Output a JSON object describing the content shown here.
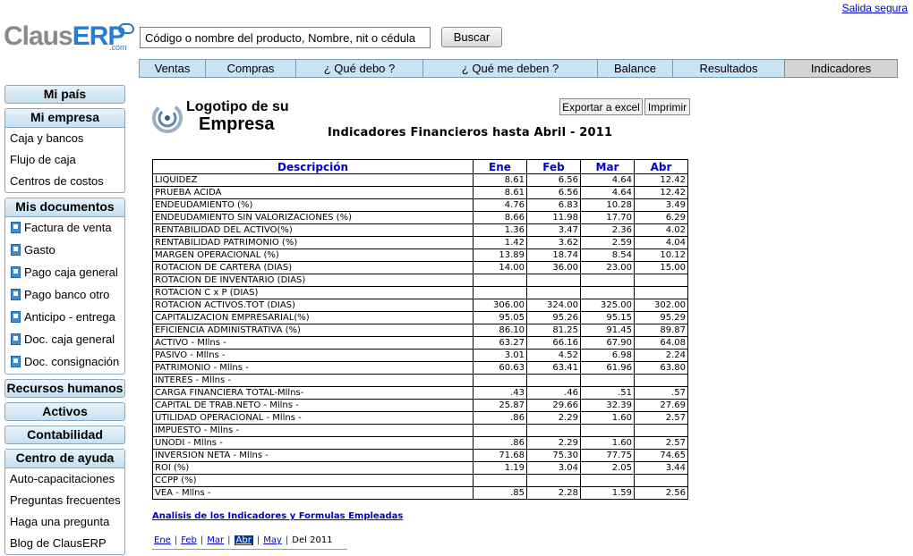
{
  "header": {
    "logout_link": "Salida segura",
    "logo_part1": "Claus",
    "logo_part2": "ERP",
    "logo_suffix": ".com",
    "search_value": "Código o nombre del producto, Nombre, nit o cédula",
    "search_button": "Buscar"
  },
  "tabs": [
    {
      "label": "Ventas"
    },
    {
      "label": "Compras"
    },
    {
      "label": "¿ Qué debo ?"
    },
    {
      "label": "¿ Qué me deben ?"
    },
    {
      "label": "Balance"
    },
    {
      "label": "Resultados"
    },
    {
      "label": "Indicadores"
    }
  ],
  "sidebar": {
    "mi_pais": "Mi país",
    "mi_empresa": {
      "title": "Mi empresa",
      "items": [
        "Caja y bancos",
        "Flujo de caja",
        "Centros de costos"
      ]
    },
    "mis_documentos": {
      "title": "Mis documentos",
      "items": [
        "Factura de venta",
        "Gasto",
        "Pago caja general",
        "Pago banco otro",
        "Anticipo - entrega",
        "Doc. caja general",
        "Doc. consignación"
      ]
    },
    "recursos_humanos": "Recursos humanos",
    "activos": "Activos",
    "contabilidad": "Contabilidad",
    "centro_ayuda": {
      "title": "Centro de ayuda",
      "items": [
        "Auto-capacitaciones",
        "Preguntas frecuentes",
        "Haga una pregunta",
        "Blog de ClausERP"
      ]
    }
  },
  "main": {
    "company_logo_line1": "Logotipo de su",
    "company_logo_line2": "Empresa",
    "export_button": "Exportar a excel",
    "print_button": "Imprimir",
    "report_title": "Indicadores Financieros hasta Abril - 2011",
    "table": {
      "headers": [
        "Descripción",
        "Ene",
        "Feb",
        "Mar",
        "Abr"
      ],
      "rows": [
        [
          "LIQUIDEZ",
          "8.61",
          "6.56",
          "4.64",
          "12.42"
        ],
        [
          "PRUEBA ACIDA",
          "8.61",
          "6.56",
          "4.64",
          "12.42"
        ],
        [
          "ENDEUDAMIENTO (%)",
          "4.76",
          "6.83",
          "10.28",
          "3.49"
        ],
        [
          "ENDEUDAMIENTO SIN VALORIZACIONES (%)",
          "8.66",
          "11.98",
          "17.70",
          "6.29"
        ],
        [
          "RENTABILIDAD DEL ACTIVO(%)",
          "1.36",
          "3.47",
          "2.36",
          "4.02"
        ],
        [
          "RENTABILIDAD PATRIMONIO (%)",
          "1.42",
          "3.62",
          "2.59",
          "4.04"
        ],
        [
          "MARGEN OPERACIONAL (%)",
          "13.89",
          "18.74",
          "8.54",
          "10.12"
        ],
        [
          "ROTACION DE CARTERA (DIAS)",
          "14.00",
          "36.00",
          "23.00",
          "15.00"
        ],
        [
          "ROTACION DE INVENTARIO (DIAS)",
          "",
          "",
          "",
          ""
        ],
        [
          "ROTACION C x P (DIAS)",
          "",
          "",
          "",
          ""
        ],
        [
          "ROTACION ACTIVOS.TOT (DIAS)",
          "306.00",
          "324.00",
          "325.00",
          "302.00"
        ],
        [
          "CAPITALIZACION EMPRESARIAL(%)",
          "95.05",
          "95.26",
          "95.15",
          "95.29"
        ],
        [
          "EFICIENCIA ADMINISTRATIVA (%)",
          "86.10",
          "81.25",
          "91.45",
          "89.87"
        ],
        [
          "ACTIVO - Mllns -",
          "63.27",
          "66.16",
          "67.90",
          "64.08"
        ],
        [
          "PASIVO - Mllns -",
          "3.01",
          "4.52",
          "6.98",
          "2.24"
        ],
        [
          "PATRIMONIO - Mllns -",
          "60.63",
          "63.41",
          "61.96",
          "63.80"
        ],
        [
          "INTERES - Mllns -",
          "",
          "",
          "",
          ""
        ],
        [
          "CARGA FINANCIERA TOTAL-Mllns-",
          ".43",
          ".46",
          ".51",
          ".57"
        ],
        [
          "CAPITAL DE TRAB.NETO - Mllns -",
          "25.87",
          "29.66",
          "32.39",
          "27.69"
        ],
        [
          "UTILIDAD OPERACIONAL - Mllns -",
          ".86",
          "2.29",
          "1.60",
          "2.57"
        ],
        [
          "IMPUESTO - Mllns -",
          "",
          "",
          "",
          ""
        ],
        [
          "UNODI - Mllns -",
          ".86",
          "2.29",
          "1.60",
          "2.57"
        ],
        [
          "INVERSION NETA - Mllns -",
          "71.68",
          "75.30",
          "77.75",
          "74.65"
        ],
        [
          "ROI (%)",
          "1.19",
          "3.04",
          "2.05",
          "3.44"
        ],
        [
          "CCPP (%)",
          "",
          "",
          "",
          ""
        ],
        [
          "VEA - Mllns -",
          ".85",
          "2.28",
          "1.59",
          "2.56"
        ]
      ]
    },
    "analysis_link": "Analisis de los Indicadores y Formulas Empleadas",
    "month_nav": {
      "months": [
        "Ene",
        "Feb",
        "Mar",
        "Abr",
        "May"
      ],
      "current_index": 3,
      "year_text": "Del 2011"
    }
  },
  "colors": {
    "link": "#0000cc",
    "tab_bg": "#c9e3f3",
    "tab_active_bg": "#d4d4d4",
    "logo_blue": "#2a7ad1",
    "logo_gray": "#8a8a8a"
  }
}
